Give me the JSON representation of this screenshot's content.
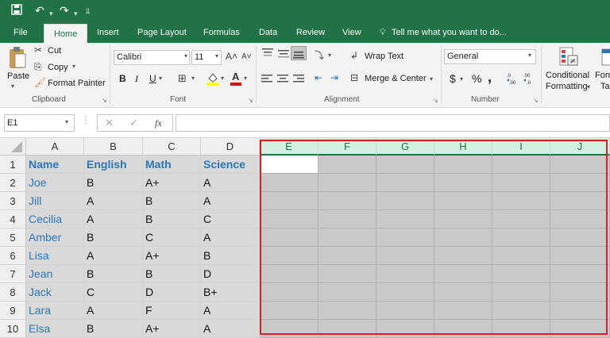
{
  "quick_access": {
    "save_icon": "save-icon",
    "undo_icon": "undo-icon",
    "redo_icon": "redo-icon",
    "customize_icon": "customize-icon"
  },
  "tabs": [
    {
      "label": "File"
    },
    {
      "label": "Home",
      "active": true
    },
    {
      "label": "Insert"
    },
    {
      "label": "Page Layout"
    },
    {
      "label": "Formulas"
    },
    {
      "label": "Data"
    },
    {
      "label": "Review"
    },
    {
      "label": "View"
    }
  ],
  "tell_me": "Tell me what you want to do...",
  "ribbon": {
    "clipboard": {
      "paste": "Paste",
      "cut": "Cut",
      "copy": "Copy",
      "format_painter": "Format Painter",
      "group": "Clipboard"
    },
    "font": {
      "name": "Calibri",
      "size": "11",
      "bold": "B",
      "italic": "I",
      "underline": "U",
      "group": "Font"
    },
    "alignment": {
      "wrap_text": "Wrap Text",
      "merge_center": "Merge & Center",
      "group": "Alignment"
    },
    "number": {
      "format": "General",
      "currency": "$",
      "percent": "%",
      "comma": ",",
      "group": "Number"
    },
    "styles": {
      "conditional_1": "Conditional",
      "conditional_2": "Formatting",
      "format_1": "Form",
      "format_2": "Ta"
    }
  },
  "formula_bar": {
    "name_box": "E1",
    "fx": "fx",
    "value": ""
  },
  "colors": {
    "excel_green": "#217346",
    "link_blue": "#2e75b6",
    "highlight_red": "#d91f1f",
    "selected_gray": "#c9c9c9"
  },
  "sheet": {
    "columns": [
      "A",
      "B",
      "C",
      "D",
      "E",
      "F",
      "G",
      "H",
      "I",
      "J"
    ],
    "rows": [
      "1",
      "2",
      "3",
      "4",
      "5",
      "6",
      "7",
      "8",
      "9",
      "10"
    ],
    "data": [
      [
        "Name",
        "English",
        "Math",
        "Science"
      ],
      [
        "Joe",
        "B",
        "A+",
        "A"
      ],
      [
        "Jill",
        "A",
        "B",
        "A"
      ],
      [
        "Cecilia",
        "A",
        "B",
        "C"
      ],
      [
        "Amber",
        "B",
        "C",
        "A"
      ],
      [
        "Lisa",
        "A",
        "A+",
        "B"
      ],
      [
        "Jean",
        "B",
        "B",
        "D"
      ],
      [
        "Jack",
        "C",
        "D",
        "B+"
      ],
      [
        "Lara",
        "A",
        "F",
        "A"
      ],
      [
        "Elsa",
        "B",
        "A+",
        "A"
      ]
    ],
    "active_cell": "E1",
    "selected_range": "E1:J10"
  }
}
